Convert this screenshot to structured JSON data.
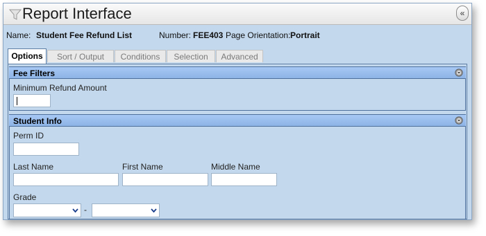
{
  "window": {
    "title": "Report Interface",
    "collapse_label": "«"
  },
  "info": {
    "name_label": "Name:",
    "name_value": "Student Fee Refund List",
    "number_label": "Number:",
    "number_value": "FEE403",
    "orientation_label": "Page Orientation:",
    "orientation_value": "Portrait"
  },
  "tabs": [
    {
      "label": "Options",
      "active": true
    },
    {
      "label": "Sort / Output",
      "active": false
    },
    {
      "label": "Conditions",
      "active": false
    },
    {
      "label": "Selection",
      "active": false
    },
    {
      "label": "Advanced",
      "active": false
    }
  ],
  "fee_filters": {
    "header": "Fee Filters",
    "min_refund_label": "Minimum Refund Amount",
    "min_refund_value": ""
  },
  "student_info": {
    "header": "Student Info",
    "perm_id_label": "Perm ID",
    "perm_id_value": "",
    "last_name_label": "Last Name",
    "last_name_value": "",
    "first_name_label": "First Name",
    "first_name_value": "",
    "middle_name_label": "Middle Name",
    "middle_name_value": "",
    "grade_label": "Grade",
    "grade_from_value": "",
    "grade_separator": "-",
    "grade_to_value": ""
  },
  "colors": {
    "panel_bg": "#c3d8ec",
    "header_bg": "#8db4e6",
    "border": "#4d6f9c"
  }
}
